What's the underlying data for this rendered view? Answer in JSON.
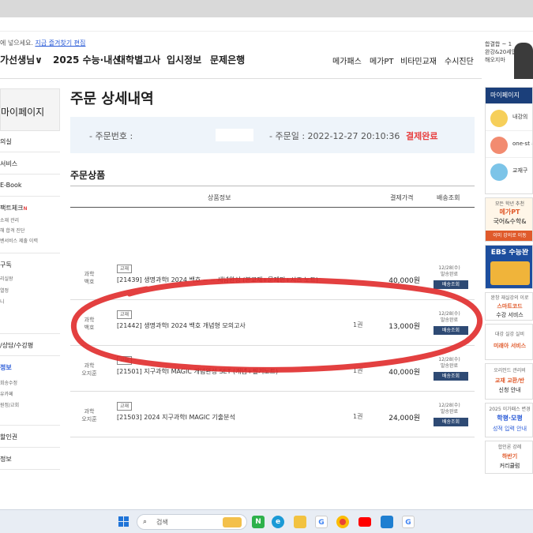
{
  "notice": {
    "text": "에 넣으세요.",
    "link": "지금 즐겨찾기 편집"
  },
  "gnb": {
    "items": [
      "가선생님∨",
      "2025 수능·내신",
      "대학별고사",
      "입시정보",
      "문제은행"
    ],
    "right": [
      "메가패스",
      "메가PT",
      "비타민교재",
      "수시진단"
    ]
  },
  "top_banner": {
    "line1": "합결합 ~ 1",
    "line2": "완강&20세입니",
    "line3": "해오지마"
  },
  "sidebar": {
    "title": "마이페이지",
    "items": [
      {
        "label": "의실"
      },
      {
        "label": "서비스"
      },
      {
        "label": "E-Book"
      },
      {
        "label": "팩트체크",
        "badge": "N"
      },
      {
        "label": "구독"
      },
      {
        "label": "/상담/수강평"
      },
      {
        "label": "정보"
      },
      {
        "label": "할인권"
      },
      {
        "label": "정보"
      }
    ],
    "subs": [
      "소재 관리",
      "해 합격 진단",
      "벤서비스 제출 이력",
      "리실왕",
      "열정",
      "니",
      "회송수정",
      "유카페",
      "원정/교회"
    ]
  },
  "page": {
    "title": "주문 상세내역",
    "order_no_label": "- 주문번호 :",
    "order_date_label": "- 주문일 : 2022-12-27 20:10:36",
    "status": "결제완료",
    "section": "주문상품"
  },
  "table": {
    "headers": [
      "상품정보",
      "결제가격",
      "배송조회"
    ],
    "rows": [
      {
        "subject1": "과학",
        "subject2": "백호",
        "badge": "교재",
        "name": "[21439] 생명과학I 2024 백호 ~ ~ 세념완성 (본교재+문제편+시즈 노트)",
        "qty": "",
        "price": "40,000원",
        "date1": "12/28(수)",
        "date2": "발송완료",
        "track": "배송조회"
      },
      {
        "subject1": "과학",
        "subject2": "백호",
        "badge": "교재",
        "name": "[21442] 생명과학I 2024 백호 개념형 모의고사",
        "qty": "1권",
        "price": "13,000원",
        "date1": "12/28(수)",
        "date2": "발송완료",
        "track": "배송조회"
      },
      {
        "subject1": "과학",
        "subject2": "오지훈",
        "badge": "교재",
        "name": "[21501] 지구과학I MAGIC 개념완성 SET (개념+필기노트)",
        "qty": "1권",
        "price": "40,000원",
        "date1": "12/28(수)",
        "date2": "발송완료",
        "track": "배송조회"
      },
      {
        "subject1": "과학",
        "subject2": "오지훈",
        "badge": "교재",
        "name": "[21503] 2024 지구과학I MAGIC 기출분석",
        "qty": "1권",
        "price": "24,000원",
        "date1": "12/28(수)",
        "date2": "발송완료",
        "track": "배송조회"
      }
    ]
  },
  "right_side": {
    "head": "마이페이지",
    "items": [
      "내강의",
      "one-st 수강신",
      "교재구"
    ],
    "ads": [
      {
        "l1": "모든 학년 추천",
        "l2": "메가PT",
        "l3": "국어&수학&",
        "l4": "이미 강의로 이동"
      },
      {
        "l1": "EBS 수능완",
        "l2": "",
        "l3": "",
        "l4": ""
      },
      {
        "l1": "완창 재실강의 이로",
        "l2": "스마트코드",
        "l3": "수강 서비스",
        "l4": ""
      },
      {
        "l1": "대강 실강 실비",
        "l2": "미래아 서비스",
        "l3": "",
        "l4": ""
      },
      {
        "l1": "오리인드 관리비",
        "l2": "교재 교환/반",
        "l3": "신청 안내",
        "l4": ""
      },
      {
        "l1": "2025 이가패스 변경",
        "l2": "학평·모평",
        "l3": "성적 입력 안내",
        "l4": ""
      },
      {
        "l1": "합인론 강례",
        "l2": "하반기",
        "l3": "커리큘럼",
        "l4": ""
      }
    ]
  },
  "taskbar": {
    "search_placeholder": "검색",
    "icons": [
      "N",
      "e",
      "folder",
      "G",
      "chrome",
      "youtube",
      "vscode",
      "G"
    ]
  },
  "colors": {
    "accent": "#e84040",
    "nav_blue": "#1b3f7a",
    "track_btn": "#2e4a74",
    "annotation": "#e02b2b"
  }
}
